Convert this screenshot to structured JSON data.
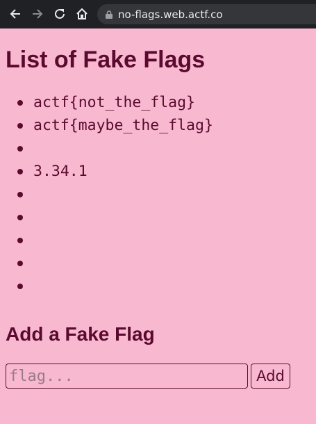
{
  "browser": {
    "url": "no-flags.web.actf.co",
    "icons": [
      "back-arrow-icon",
      "forward-arrow-icon",
      "reload-icon",
      "home-icon",
      "lock-icon"
    ]
  },
  "page": {
    "title": "List of Fake Flags",
    "flags": [
      "actf{not_the_flag}",
      "actf{maybe_the_flag}",
      "",
      "3.34.1",
      "",
      "",
      "",
      "",
      ""
    ],
    "form_heading": "Add a Fake Flag",
    "input_placeholder": "flag...",
    "input_value": "",
    "button_label": "Add"
  },
  "colors": {
    "background": "#f8b8d0",
    "text": "#5a0a2e",
    "toolbar": "#202124"
  }
}
